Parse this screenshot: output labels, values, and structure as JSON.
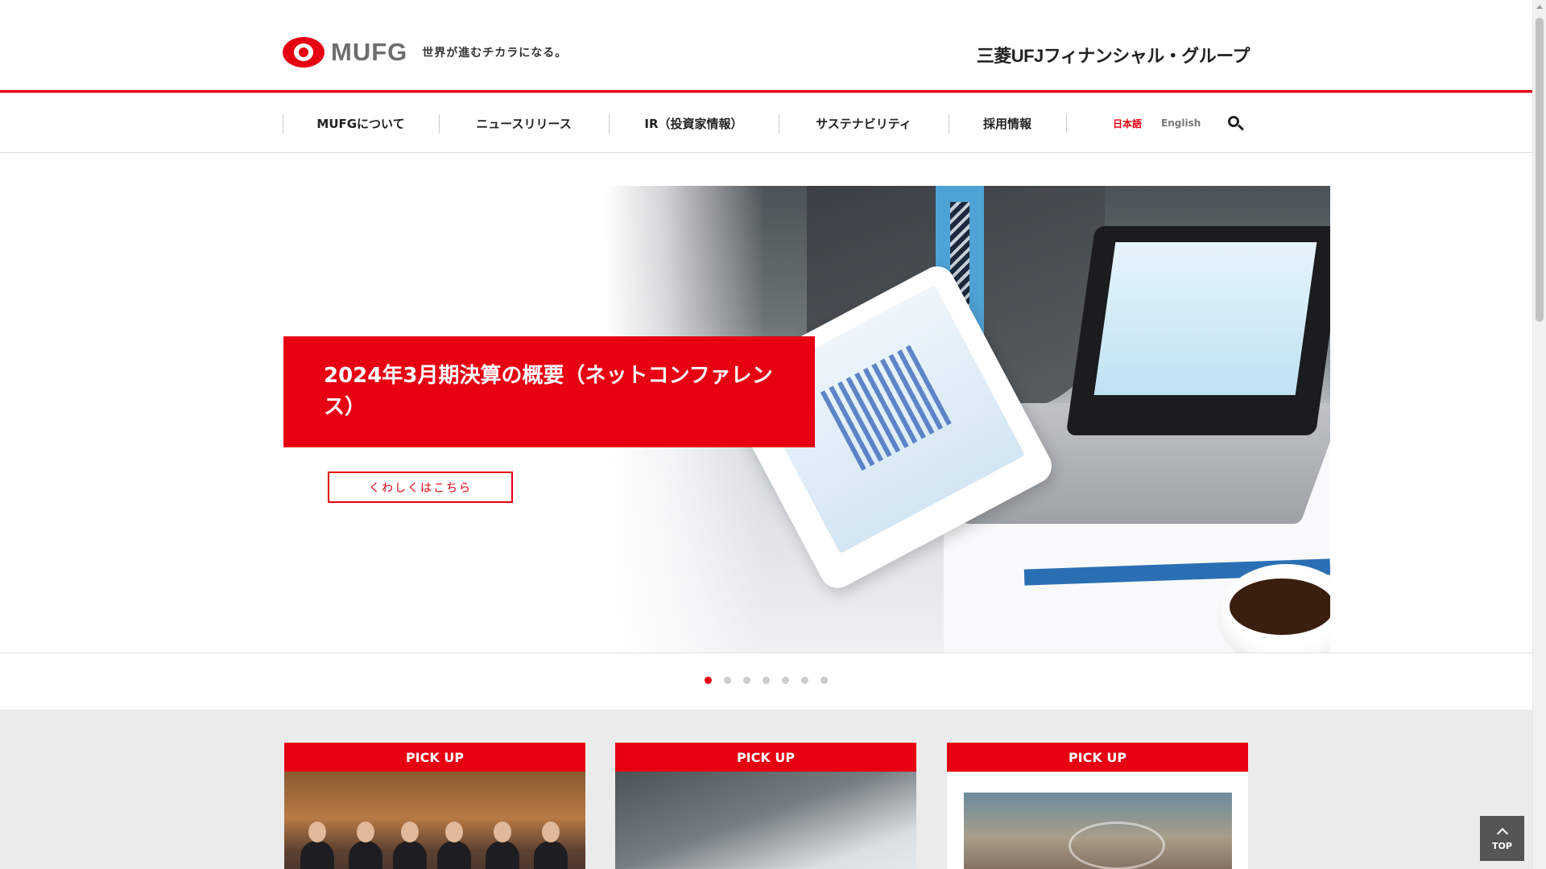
{
  "header": {
    "logo_text": "MUFG",
    "tagline": "世界が進むチカラになる。",
    "group_name": "三菱UFJフィナンシャル・グループ"
  },
  "nav": {
    "items": [
      {
        "label": "MUFGについて"
      },
      {
        "label": "ニュースリリース"
      },
      {
        "label": "IR（投資家情報）"
      },
      {
        "label": "サステナビリティ"
      },
      {
        "label": "採用情報"
      }
    ],
    "lang_jp": "日本語",
    "lang_en": "English",
    "search_icon": "search-icon"
  },
  "hero": {
    "title": "2024年3月期決算の概要（ネットコンファレンス）",
    "button_label": "くわしくはこちら",
    "slide_count": 7,
    "active_slide": 1
  },
  "pickup": {
    "cards": [
      {
        "label": "PICK UP"
      },
      {
        "label": "PICK UP"
      },
      {
        "label": "PICK UP"
      }
    ]
  },
  "top_button": {
    "label": "TOP"
  },
  "colors": {
    "accent": "#e60012",
    "background_band": "#ebebeb"
  }
}
